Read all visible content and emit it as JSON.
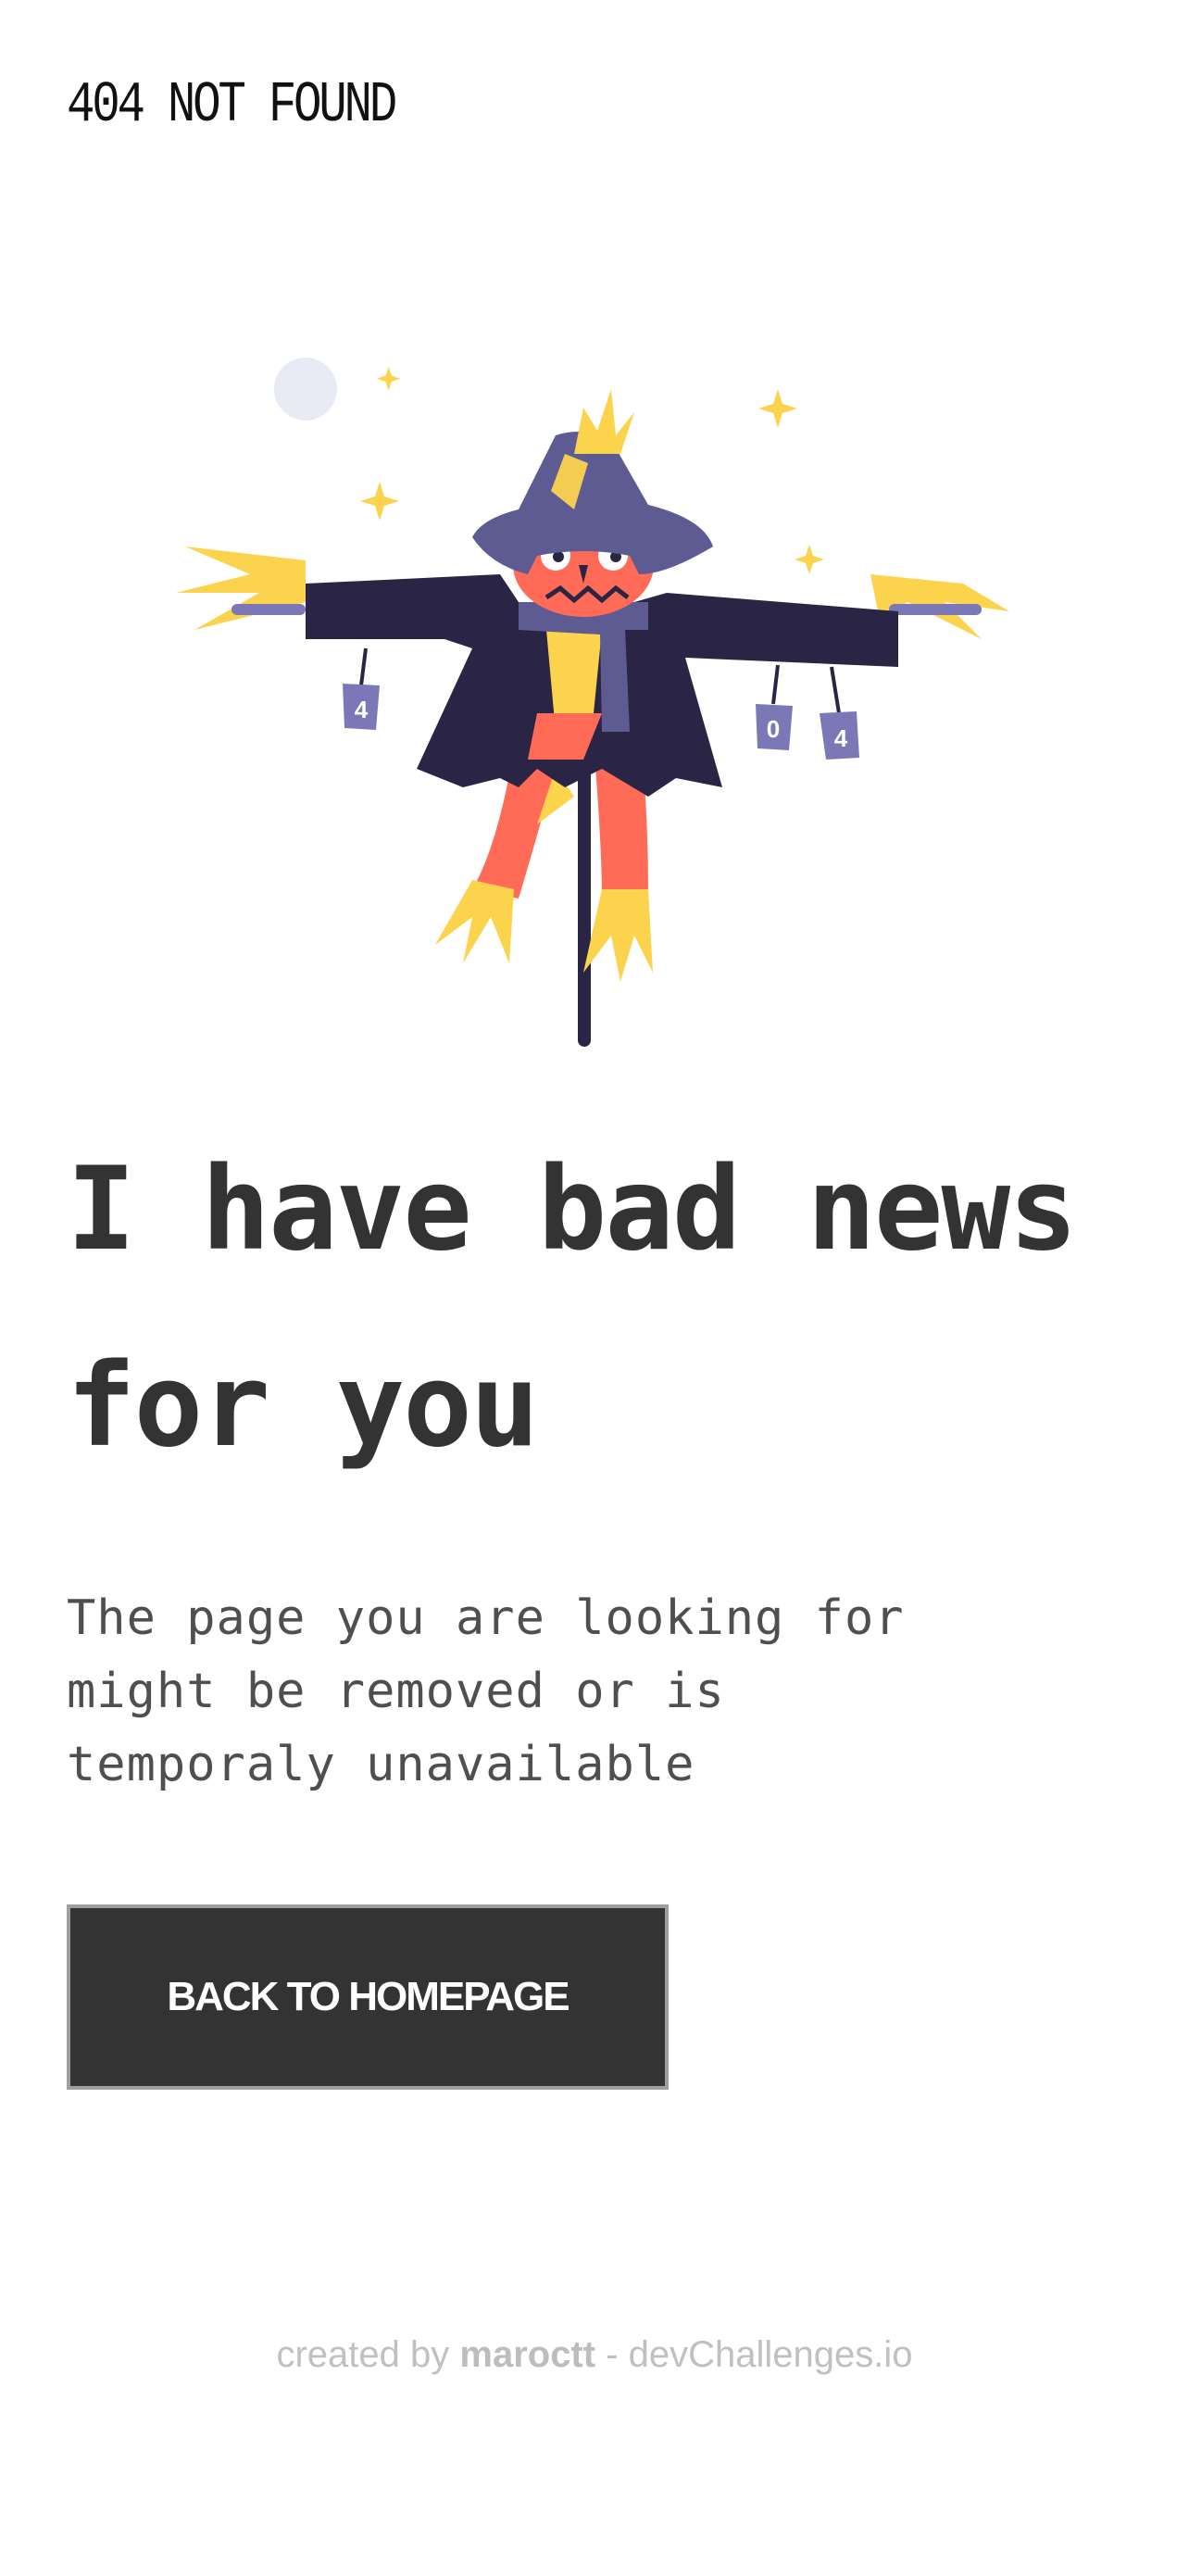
{
  "header": {
    "logo_text": "404 NOT FOUND"
  },
  "hero": {
    "headline": "I have bad news for you",
    "description": "The page you are looking for might be removed or is temporaly unavailable",
    "button_label": "BACK TO HOMEPAGE"
  },
  "illustration": {
    "subject": "scarecrow",
    "can_labels": [
      "4",
      "0",
      "4"
    ]
  },
  "footer": {
    "prefix": "created by ",
    "author": "maroctt",
    "separator": " - ",
    "site": "devChallenges.io"
  },
  "colors": {
    "text_dark": "#333333",
    "hat": "#5e5b93",
    "coat": "#2b2545",
    "body": "#ff6b57",
    "straw": "#fcd34d",
    "moon": "#e8ebf5"
  }
}
